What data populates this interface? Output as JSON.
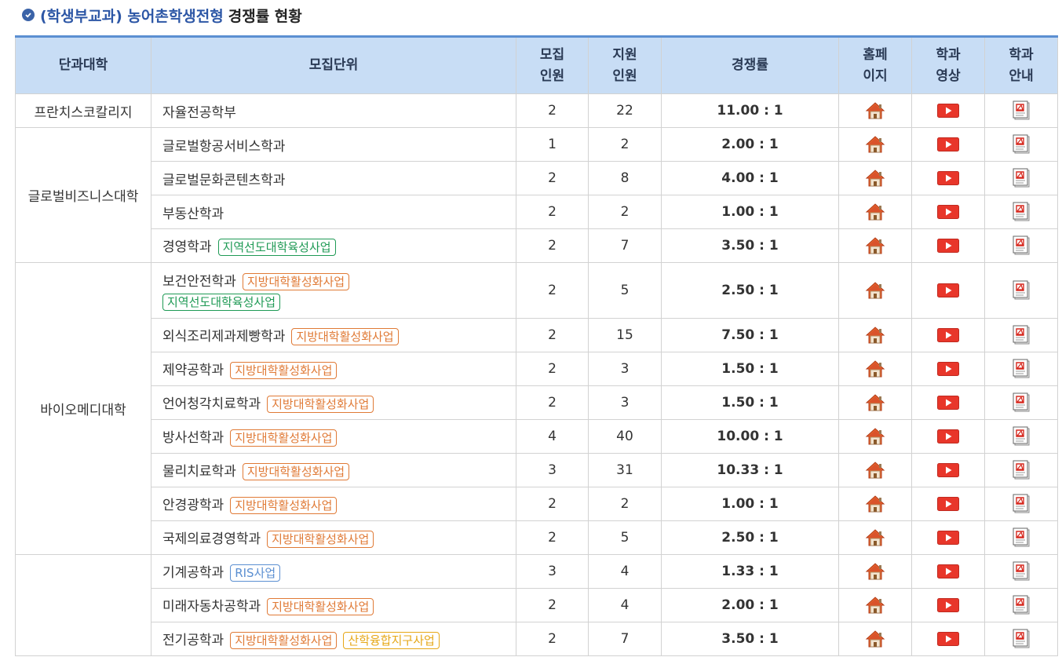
{
  "title": {
    "blue": "(학생부교과) 농어촌학생전형",
    "dark": "경쟁률 현황"
  },
  "headers": {
    "college": "단과대학",
    "unit": "모집단위",
    "quota": [
      "모집",
      "인원"
    ],
    "applicants": [
      "지원",
      "인원"
    ],
    "rate": "경쟁률",
    "home": [
      "홈페",
      "이지"
    ],
    "video": [
      "학과",
      "영상"
    ],
    "guide": [
      "학과",
      "안내"
    ]
  },
  "icons": {
    "home": "home-icon",
    "video": "play-video-icon",
    "guide": "pdf-document-icon"
  },
  "colors": {
    "header_bg": "#c8ddf5",
    "accent": "#5b8fd1",
    "home_red": "#d9532b",
    "video_red": "#e8362a"
  },
  "rows": [
    {
      "college": "프란치스코칼리지",
      "rowspan": 1,
      "unit": "자율전공학부",
      "tags": [],
      "quota": "2",
      "applicants": "22",
      "rate": "11.00 : 1"
    },
    {
      "college": "글로벌비즈니스대학",
      "rowspan": 4,
      "unit": "글로벌항공서비스학과",
      "tags": [],
      "quota": "1",
      "applicants": "2",
      "rate": "2.00 : 1"
    },
    {
      "unit": "글로벌문화콘텐츠학과",
      "tags": [],
      "quota": "2",
      "applicants": "8",
      "rate": "4.00 : 1"
    },
    {
      "unit": "부동산학과",
      "tags": [],
      "quota": "2",
      "applicants": "2",
      "rate": "1.00 : 1"
    },
    {
      "unit": "경영학과",
      "tags": [
        {
          "text": "지역선도대학육성사업",
          "color": "green"
        }
      ],
      "quota": "2",
      "applicants": "7",
      "rate": "3.50 : 1"
    },
    {
      "college": "바이오메디대학",
      "rowspan": 8,
      "unit": "보건안전학과",
      "tall": true,
      "tags": [
        {
          "text": "지방대학활성화사업",
          "color": "orange"
        },
        {
          "text": "지역선도대학육성사업",
          "color": "green",
          "wrap": true
        }
      ],
      "quota": "2",
      "applicants": "5",
      "rate": "2.50 : 1"
    },
    {
      "unit": "외식조리제과제빵학과",
      "tags": [
        {
          "text": "지방대학활성화사업",
          "color": "orange"
        }
      ],
      "quota": "2",
      "applicants": "15",
      "rate": "7.50 : 1"
    },
    {
      "unit": "제약공학과",
      "tags": [
        {
          "text": "지방대학활성화사업",
          "color": "orange"
        }
      ],
      "quota": "2",
      "applicants": "3",
      "rate": "1.50 : 1"
    },
    {
      "unit": "언어청각치료학과",
      "tags": [
        {
          "text": "지방대학활성화사업",
          "color": "orange"
        }
      ],
      "quota": "2",
      "applicants": "3",
      "rate": "1.50 : 1"
    },
    {
      "unit": "방사선학과",
      "tags": [
        {
          "text": "지방대학활성화사업",
          "color": "orange"
        }
      ],
      "quota": "4",
      "applicants": "40",
      "rate": "10.00 : 1"
    },
    {
      "unit": "물리치료학과",
      "tags": [
        {
          "text": "지방대학활성화사업",
          "color": "orange"
        }
      ],
      "quota": "3",
      "applicants": "31",
      "rate": "10.33 : 1"
    },
    {
      "unit": "안경광학과",
      "tags": [
        {
          "text": "지방대학활성화사업",
          "color": "orange"
        }
      ],
      "quota": "2",
      "applicants": "2",
      "rate": "1.00 : 1"
    },
    {
      "unit": "국제의료경영학과",
      "tags": [
        {
          "text": "지방대학활성화사업",
          "color": "orange"
        }
      ],
      "quota": "2",
      "applicants": "5",
      "rate": "2.50 : 1"
    },
    {
      "college": "",
      "rowspan": 3,
      "unit": "기계공학과",
      "tags": [
        {
          "text": "RIS사업",
          "color": "blue"
        }
      ],
      "quota": "3",
      "applicants": "4",
      "rate": "1.33 : 1"
    },
    {
      "unit": "미래자동차공학과",
      "tags": [
        {
          "text": "지방대학활성화사업",
          "color": "orange"
        }
      ],
      "quota": "2",
      "applicants": "4",
      "rate": "2.00 : 1"
    },
    {
      "unit": "전기공학과",
      "tags": [
        {
          "text": "지방대학활성화사업",
          "color": "orange"
        },
        {
          "text": "산학융합지구사업",
          "color": "yellow"
        }
      ],
      "quota": "2",
      "applicants": "7",
      "rate": "3.50 : 1"
    }
  ]
}
